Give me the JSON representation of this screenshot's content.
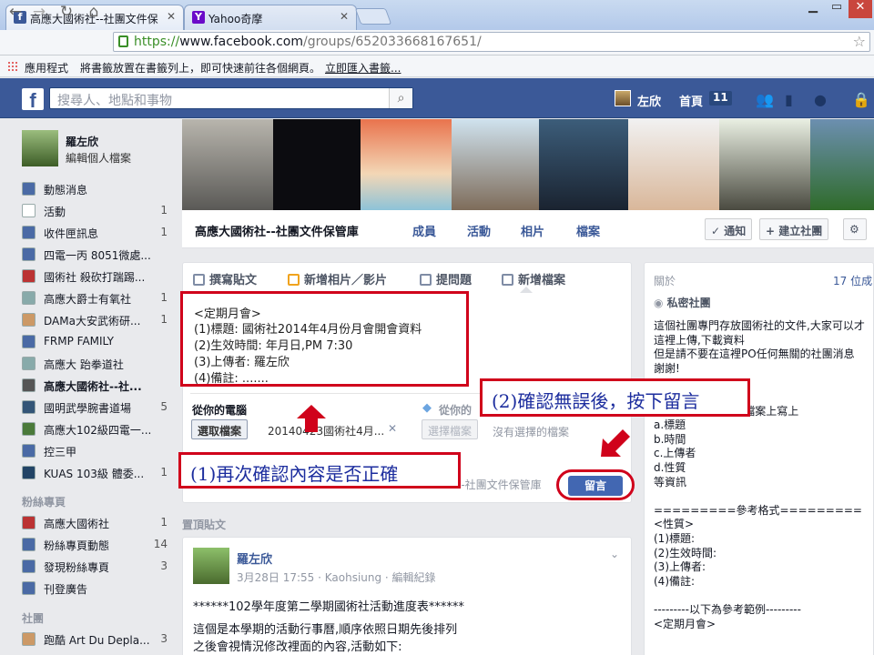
{
  "browser": {
    "tabs": [
      {
        "title": "高應大國術社--社團文件保",
        "favicon": "f"
      },
      {
        "title": "Yahoo奇摩",
        "favicon": "Y"
      }
    ],
    "url_scheme": "https://",
    "url_host": "www.facebook.com",
    "url_path": "/groups/652033668167651/",
    "bookmarks_apps": "應用程式",
    "bookmarks_hint": "將書籤放置在書籤列上，即可快速前往各個網頁。",
    "bookmarks_import": "立即匯入書籤..."
  },
  "fb": {
    "search_placeholder": "搜尋人、地點和事物",
    "user_name": "左欣",
    "home_label": "首頁",
    "home_count": "11"
  },
  "sidebar": {
    "profile_name": "羅左欣",
    "profile_edit": "編輯個人檔案",
    "items": [
      {
        "label": "動態消息",
        "count": ""
      },
      {
        "label": "活動",
        "count": "1"
      },
      {
        "label": "收件匣訊息",
        "count": "1"
      },
      {
        "label": "四電一丙 8051微處...",
        "count": ""
      },
      {
        "label": "國術社 殺砍打踹踢...",
        "count": ""
      },
      {
        "label": "高應大爵士有氧社",
        "count": "1"
      },
      {
        "label": "DAMa大安武術研...",
        "count": "1"
      },
      {
        "label": "FRMP FAMILY",
        "count": ""
      },
      {
        "label": "高應大 跆拳道社",
        "count": ""
      },
      {
        "label": "高應大國術社--社...",
        "count": ""
      },
      {
        "label": "國明武學腕書道場",
        "count": "5"
      },
      {
        "label": "高應大102級四電一...",
        "count": ""
      },
      {
        "label": "控三甲",
        "count": ""
      },
      {
        "label": "KUAS 103級 體委...",
        "count": "1"
      }
    ],
    "fans_header": "粉絲專頁",
    "fans_items": [
      {
        "label": "高應大國術社",
        "count": "1"
      },
      {
        "label": "粉絲專頁動態",
        "count": "14"
      },
      {
        "label": "發現粉絲專頁",
        "count": "3"
      },
      {
        "label": "刊登廣告",
        "count": ""
      }
    ],
    "groups_header": "社團",
    "groups_items": [
      {
        "label": "跑酷 Art Du Depla...",
        "count": "3"
      }
    ]
  },
  "group": {
    "name": "高應大國術社--社團文件保管庫",
    "tabs": [
      "成員",
      "活動",
      "相片",
      "檔案"
    ],
    "notify_label": "✓ 通知",
    "create_label": "+ 建立社團"
  },
  "composer": {
    "tabs": [
      "撰寫貼文",
      "新增相片／影片",
      "提問題",
      "新增檔案"
    ],
    "lines": [
      "<定期月會>",
      "(1)標題: 國術社2014年4月份月會開會資料",
      "(2)生效時間: 年月日,PM 7:30",
      "(3)上傳者: 羅左欣",
      "(4)備註: ......."
    ],
    "from_computer": "從你的電腦",
    "choose_file": "選取檔案",
    "file_name": "20140423國術社4月...",
    "from_dropbox": "從你的",
    "choose_file2": "選擇檔案",
    "no_file": "沒有選擇的檔案",
    "post_to": "--社團文件保管庫",
    "post_button": "留言",
    "annotation1": "(1)再次確認內容是否正確",
    "annotation2": "(2)確認無誤後，按下留言"
  },
  "pinned": {
    "label": "置頂貼文",
    "author": "羅左欣",
    "meta": "3月28日 17:55 · Kaohsiung · 編輯紀錄",
    "lines": [
      "******102學年度第二學期國術社活動進度表******",
      "這個是本學期的活動行事曆,順序依照日期先後排列",
      "之後會視情況修改裡面的內容,活動如下:"
    ]
  },
  "about": {
    "header": "關於",
    "members": "17 位成",
    "privacy": "私密社團",
    "lines": [
      "這個社團專門存放國術社的文件,大家可以才",
      "這裡上傳,下載資料",
      "但是請不要在這裡PO任何無關的社團消息",
      "謝謝!",
      "",
      "**********",
      "1. 請務必在每一份檔案上寫上",
      "a.標題",
      "b.時間",
      "c.上傳者",
      "d.性質",
      "等資訊",
      "",
      "=========參考格式=========",
      "<性質>",
      "(1)標題:",
      "(2)生效時間:",
      "(3)上傳者:",
      "(4)備註:",
      "",
      "---------以下為參考範例---------",
      "<定期月會>"
    ]
  },
  "colors": {
    "fb_blue": "#3b5998",
    "annotation_red": "#d0021b",
    "annotation_text": "#1c2d9e"
  }
}
